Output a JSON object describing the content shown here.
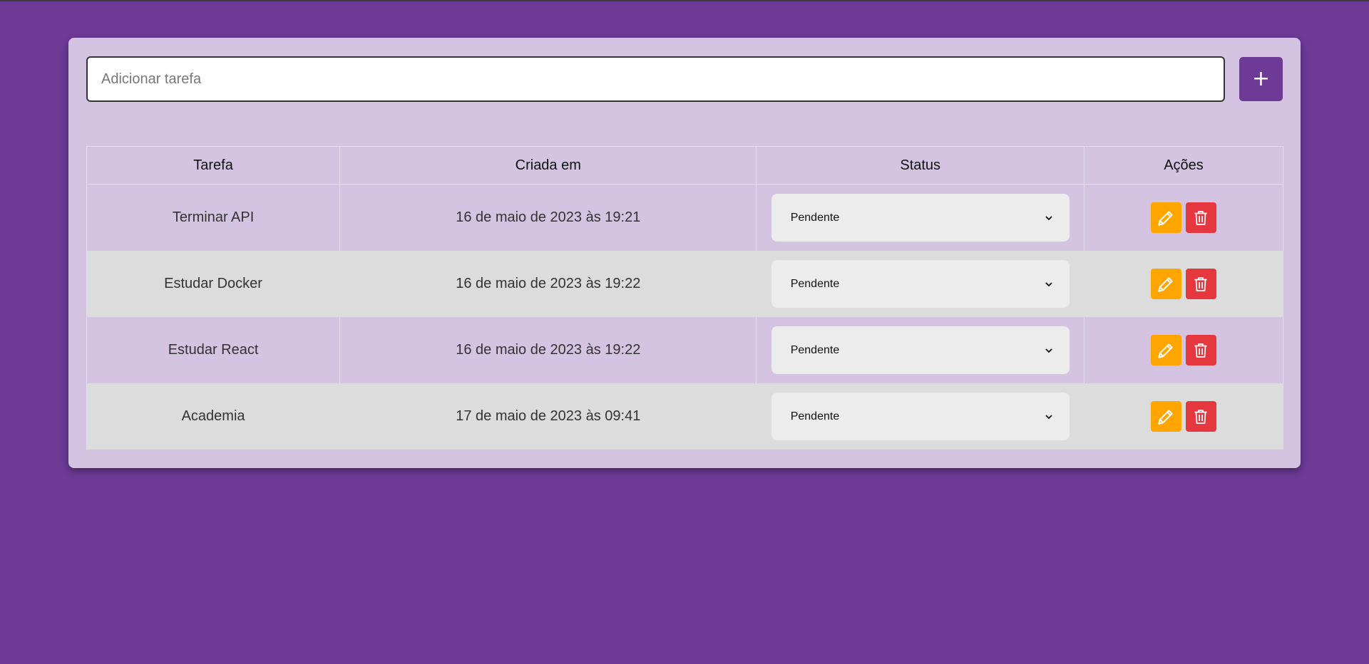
{
  "form": {
    "input_placeholder": "Adicionar tarefa",
    "input_value": "",
    "add_button_label": "+"
  },
  "table": {
    "headers": {
      "task": "Tarefa",
      "created": "Criada em",
      "status": "Status",
      "actions": "Ações"
    },
    "rows": [
      {
        "task": "Terminar API",
        "created": "16 de maio de 2023 às 19:21",
        "status": "Pendente"
      },
      {
        "task": "Estudar Docker",
        "created": "16 de maio de 2023 às 19:22",
        "status": "Pendente"
      },
      {
        "task": "Estudar React",
        "created": "16 de maio de 2023 às 19:22",
        "status": "Pendente"
      },
      {
        "task": "Academia",
        "created": "17 de maio de 2023 às 09:41",
        "status": "Pendente"
      }
    ]
  },
  "icons": {
    "edit": "pencil-icon",
    "delete": "trash-icon",
    "select_arrow": "chevron-down-icon"
  },
  "colors": {
    "background": "#6d3a96",
    "card": "#d4c4e1",
    "row_alt": "#dcdcdc",
    "edit": "#ffa500",
    "delete": "#e5383e"
  }
}
